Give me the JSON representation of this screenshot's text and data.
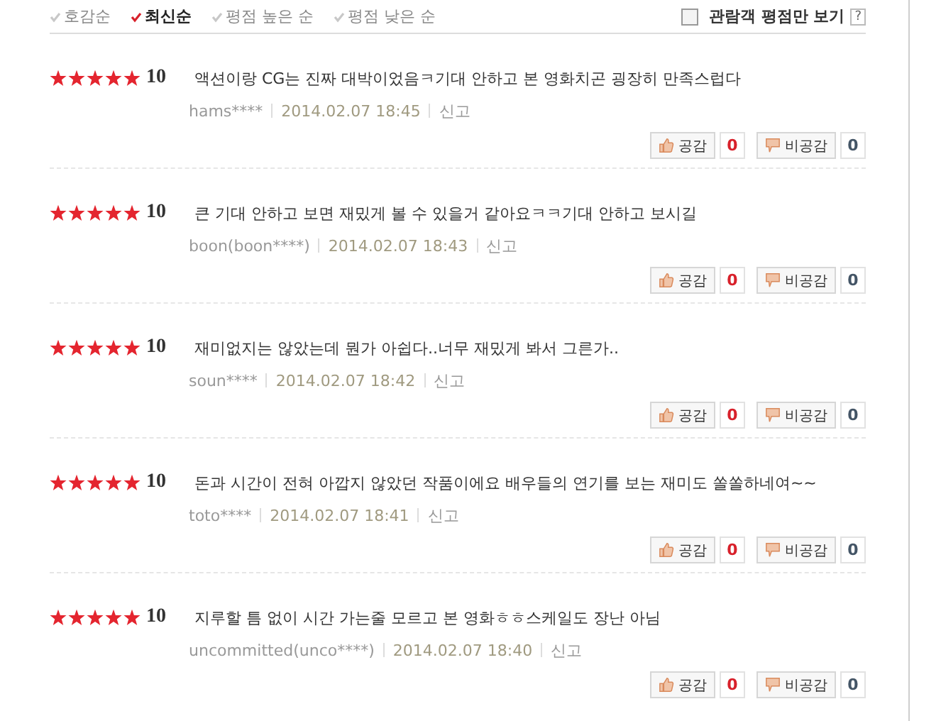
{
  "sort_tabs": [
    {
      "label": "호감순",
      "selected": false
    },
    {
      "label": "최신순",
      "selected": true
    },
    {
      "label": "평점 높은 순",
      "selected": false
    },
    {
      "label": "평점 낮은 순",
      "selected": false
    }
  ],
  "audience_filter": {
    "label": "관람객 평점만 보기",
    "checked": false,
    "help": "?"
  },
  "reviews": [
    {
      "stars": 5,
      "score": "10",
      "text": "액션이랑 CG는 진짜 대박이었음ㅋ기대 안하고 본 영화치곤 굉장히 만족스럽다",
      "user": "hams****",
      "date": "2014.02.07 18:45",
      "report": "신고",
      "like_label": "공감",
      "likes": "0",
      "dislike_label": "비공감",
      "dislikes": "0"
    },
    {
      "stars": 5,
      "score": "10",
      "text": "큰 기대 안하고 보면 재밌게 볼 수 있을거 같아요ㅋㅋ기대 안하고 보시길",
      "user": "boon(boon****)",
      "date": "2014.02.07 18:43",
      "report": "신고",
      "like_label": "공감",
      "likes": "0",
      "dislike_label": "비공감",
      "dislikes": "0"
    },
    {
      "stars": 5,
      "score": "10",
      "text": "재미없지는 않았는데 뭔가 아쉽다..너무 재밌게 봐서 그른가..",
      "user": "soun****",
      "date": "2014.02.07 18:42",
      "report": "신고",
      "like_label": "공감",
      "likes": "0",
      "dislike_label": "비공감",
      "dislikes": "0"
    },
    {
      "stars": 5,
      "score": "10",
      "text": "돈과 시간이 전혀 아깝지 않았던 작품이에요 배우들의 연기를 보는 재미도 쏠쏠하네여~~",
      "user": "toto****",
      "date": "2014.02.07 18:41",
      "report": "신고",
      "like_label": "공감",
      "likes": "0",
      "dislike_label": "비공감",
      "dislikes": "0"
    },
    {
      "stars": 5,
      "score": "10",
      "text": "지루할 틈 없이 시간 가는줄 모르고 본 영화ㅎㅎ스케일도 장난 아님",
      "user": "uncommitted(unco****)",
      "date": "2014.02.07 18:40",
      "report": "신고",
      "like_label": "공감",
      "likes": "0",
      "dislike_label": "비공감",
      "dislikes": "0"
    }
  ]
}
